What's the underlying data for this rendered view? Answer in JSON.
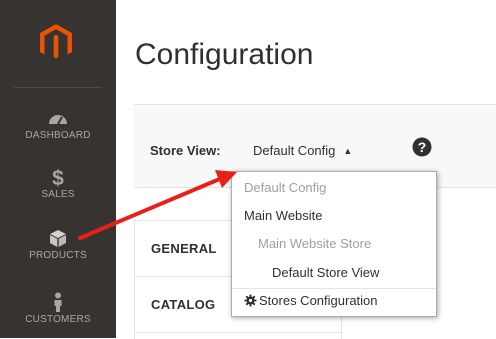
{
  "sidebar": {
    "logo_icon": "magento-logo-icon",
    "accent_color": "#eb5202",
    "items": [
      {
        "label": "DASHBOARD",
        "icon": "speedometer-icon"
      },
      {
        "label": "SALES",
        "icon": "dollar-icon"
      },
      {
        "label": "PRODUCTS",
        "icon": "cube-icon"
      },
      {
        "label": "CUSTOMERS",
        "icon": "person-icon"
      }
    ]
  },
  "header": {
    "title": "Configuration"
  },
  "toolbar": {
    "store_view_label": "Store View:",
    "store_view_value": "Default Config",
    "caret": "▲",
    "help_icon": "question-circle-icon"
  },
  "dropdown": {
    "items": [
      {
        "label": "Default Config",
        "state": "disabled"
      },
      {
        "label": "Main Website",
        "state": "active"
      },
      {
        "label": "Main Website Store",
        "state": "disabled"
      },
      {
        "label": "Default Store View",
        "state": "active"
      }
    ],
    "footer_label": "Stores Configuration",
    "footer_icon": "gear-icon"
  },
  "tabs": [
    {
      "label": "GENERAL"
    },
    {
      "label": "CATALOG"
    }
  ],
  "annotation": {
    "arrow_color": "#e8201a"
  }
}
